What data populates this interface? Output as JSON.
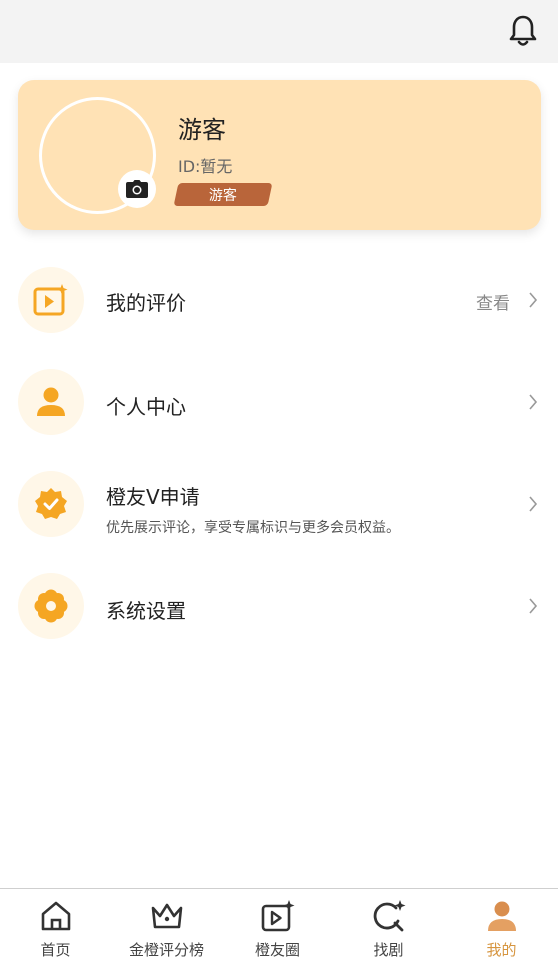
{
  "profile": {
    "name": "游客",
    "id_text": "ID:暂无",
    "badge": "游客"
  },
  "menu": [
    {
      "label": "我的评价",
      "right_text": "查看",
      "icon": "video-star-icon"
    },
    {
      "label": "个人中心",
      "icon": "person-icon"
    },
    {
      "label": "橙友V申请",
      "subtitle": "优先展示评论，享受专属标识与更多会员权益。",
      "icon": "verified-badge-icon"
    },
    {
      "label": "系统设置",
      "icon": "gear-flower-icon"
    }
  ],
  "tabs": [
    {
      "label": "首页",
      "icon": "home-icon"
    },
    {
      "label": "金橙评分榜",
      "icon": "crown-icon"
    },
    {
      "label": "橙友圈",
      "icon": "video-star-icon"
    },
    {
      "label": "找剧",
      "icon": "search-sparkle-icon"
    },
    {
      "label": "我的",
      "icon": "profile-icon",
      "active": true
    }
  ],
  "colors": {
    "accent": "#f5a623",
    "card_bg": "#ffe2b5",
    "badge_bg": "#b9653a",
    "active_tab": "#d6953f"
  }
}
